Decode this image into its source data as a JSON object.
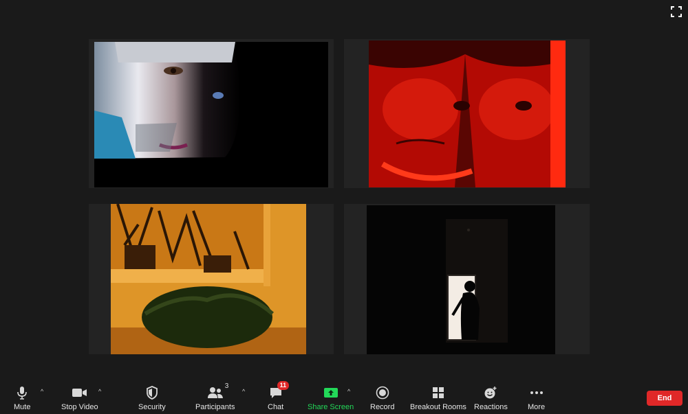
{
  "toolbar": {
    "mute_label": "Mute",
    "stop_video_label": "Stop Video",
    "security_label": "Security",
    "participants_label": "Participants",
    "participants_count": "3",
    "chat_label": "Chat",
    "chat_badge": "11",
    "share_screen_label": "Share Screen",
    "record_label": "Record",
    "breakout_rooms_label": "Breakout Rooms",
    "reactions_label": "Reactions",
    "more_label": "More",
    "end_label": "End"
  },
  "colors": {
    "background": "#1a1a1a",
    "share_screen": "#23d959",
    "end": "#e02828",
    "badge": "#e02828"
  },
  "icons": [
    "fullscreen-icon",
    "microphone-icon",
    "video-camera-icon",
    "shield-icon",
    "participants-icon",
    "chat-icon",
    "share-screen-icon",
    "record-icon",
    "breakout-rooms-icon",
    "reactions-icon",
    "more-icon"
  ]
}
